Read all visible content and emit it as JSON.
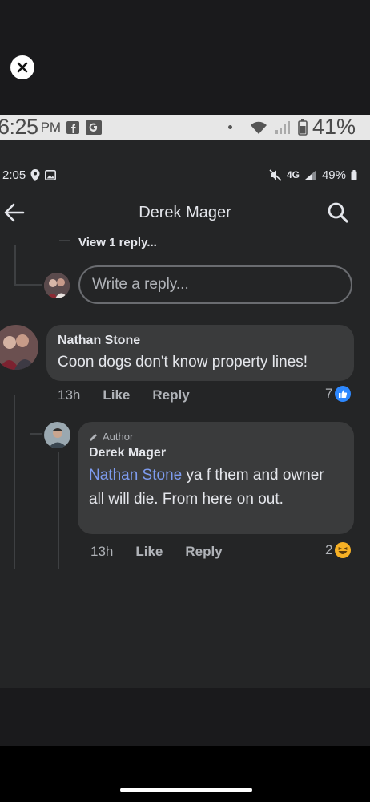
{
  "outer_status": {
    "time": "6:25",
    "ampm": "PM",
    "battery": "41%"
  },
  "inner_status": {
    "time": "2:05",
    "network": "4G",
    "battery": "49%"
  },
  "header": {
    "title": "Derek Mager"
  },
  "thread": {
    "view_reply": "View 1 reply...",
    "reply_placeholder": "Write a reply..."
  },
  "comment": {
    "author": "Nathan Stone",
    "text": "Coon dogs don't know property lines!",
    "time": "13h",
    "like_label": "Like",
    "reply_label": "Reply",
    "reaction_count": "7"
  },
  "reply": {
    "author_badge": "Author",
    "author": "Derek Mager",
    "mention": "Nathan Stone",
    "text": " ya f them and owner all will die. From here on out.",
    "time": "13h",
    "like_label": "Like",
    "reply_label": "Reply",
    "reaction_count": "2"
  },
  "colors": {
    "background": "#242526",
    "bubble": "#3a3b3c",
    "mention": "#7e9cf0",
    "like_blue": "#2d88ff",
    "haha_yellow": "#f7b125"
  }
}
